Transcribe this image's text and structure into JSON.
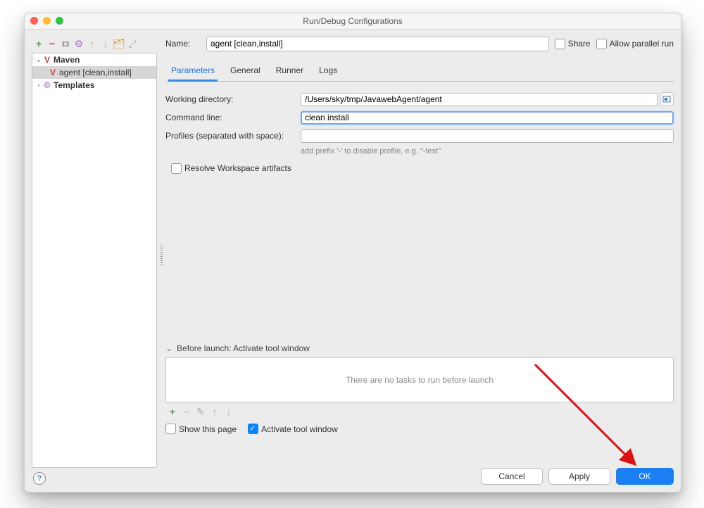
{
  "window": {
    "title": "Run/Debug Configurations"
  },
  "nameRow": {
    "label": "Name:",
    "value": "agent [clean,install]",
    "shareLabel": "Share",
    "parallelLabel": "Allow parallel run"
  },
  "sidebar": {
    "maven": {
      "label": "Maven"
    },
    "mavenItem": {
      "label": "agent [clean,install]"
    },
    "templates": {
      "label": "Templates"
    }
  },
  "tabs": {
    "parameters": "Parameters",
    "general": "General",
    "runner": "Runner",
    "logs": "Logs"
  },
  "form": {
    "workingDirLabel": "Working directory:",
    "workingDirValue": "/Users/sky/tmp/JavawebAgent/agent",
    "commandLineLabel": "Command line:",
    "commandLineValue": "clean install",
    "profilesLabel": "Profiles (separated with space):",
    "profilesValue": "",
    "profilesHint": "add prefix '-' to disable profile, e.g. \"-test\"",
    "resolveLabel": "Resolve Workspace artifacts"
  },
  "before": {
    "header": "Before launch: Activate tool window",
    "empty": "There are no tasks to run before launch",
    "showPageLabel": "Show this page",
    "activateLabel": "Activate tool window"
  },
  "buttons": {
    "cancel": "Cancel",
    "apply": "Apply",
    "ok": "OK"
  },
  "toolbarGlyphs": {
    "add": "+",
    "remove": "−",
    "copy": "⧉",
    "gear": "⚙",
    "up": "↑",
    "down": "↓",
    "folder": "🗂",
    "expand": "⤢",
    "edit": "✎"
  }
}
